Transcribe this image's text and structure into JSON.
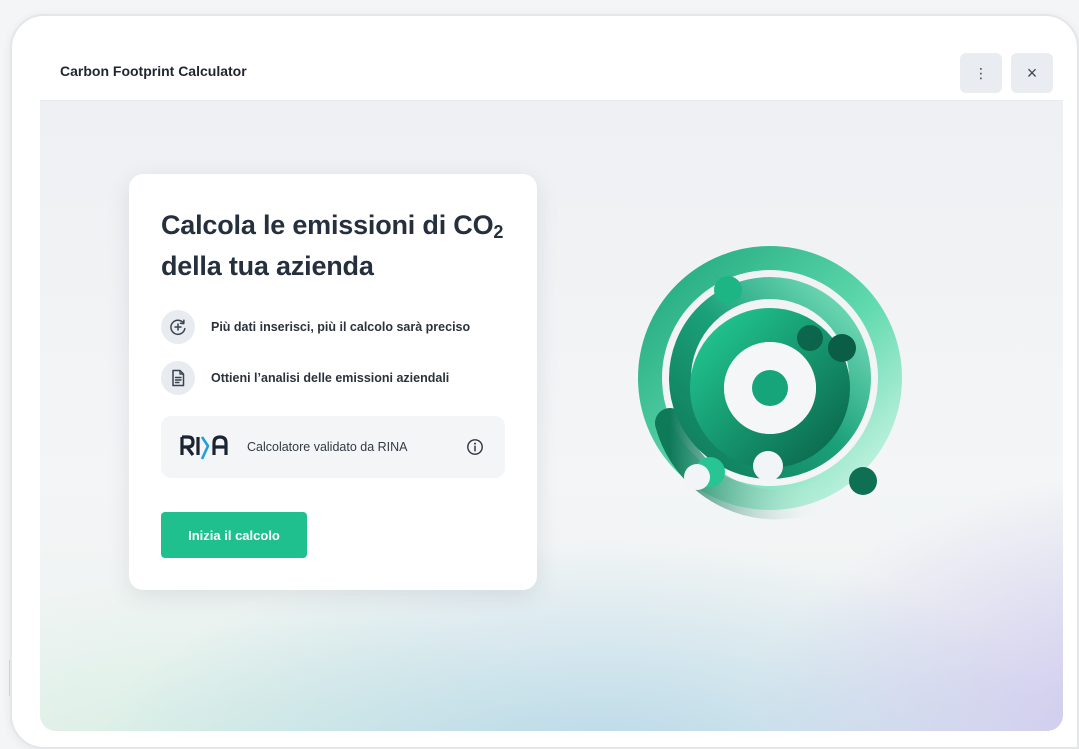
{
  "header": {
    "title": "Carbon Footprint Calculator",
    "menu_glyph": "⋮",
    "close_glyph": "×"
  },
  "card": {
    "title_main": "Calcola le emissioni di CO",
    "title_sub": "2",
    "title_line2": "della tua azienda",
    "features": [
      {
        "icon": "plus-circle-icon",
        "text": "Più dati inserisci, più il calcolo sarà preciso"
      },
      {
        "icon": "document-icon",
        "text": "Ottieni l’analisi delle emissioni aziendali"
      }
    ],
    "rina": {
      "logo_text": "RINA",
      "text": "Calcolatore validato da RINA",
      "info_icon": "info-icon"
    },
    "cta_label": "Inizia il calcolo"
  },
  "colors": {
    "accent": "#20c08e",
    "dark_green": "#0d6b4f",
    "mint": "#a6ecd2",
    "rina_blue": "#1f9fdb",
    "rina_dark": "#1b2433"
  }
}
